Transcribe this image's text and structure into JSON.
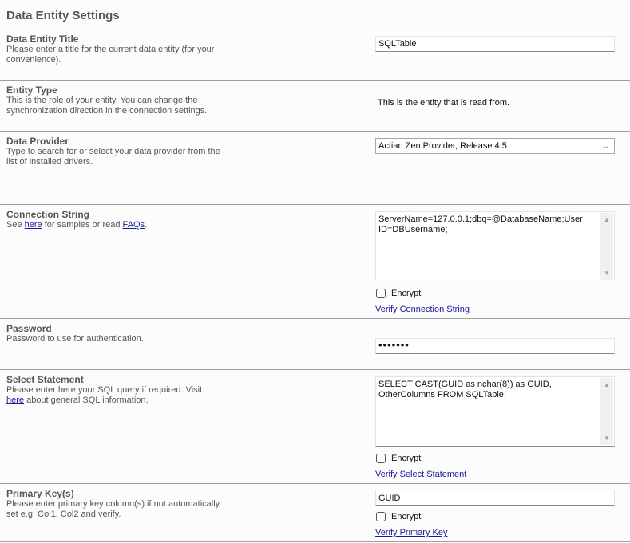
{
  "page": {
    "title": "Data Entity Settings"
  },
  "sections": {
    "entity_title": {
      "title": "Data Entity Title",
      "description": "Please enter a title for the current data entity (for your convenience).",
      "value": "SQLTable"
    },
    "entity_type": {
      "title": "Entity Type",
      "description": "This is the role of your entity. You can change the synchronization direction in the connection settings.",
      "value": "This is the entity that is read from."
    },
    "data_provider": {
      "title": "Data Provider",
      "description": "Type to search for or select your data provider from the list of installed drivers.",
      "selected": "Actian Zen Provider, Release 4.5",
      "chevron_icon": "chevron-down-icon"
    },
    "connection_string": {
      "title": "Connection String",
      "desc_prefix": "See ",
      "desc_link1": "here",
      "desc_middle": " for samples or read ",
      "desc_link2": "FAQs",
      "desc_suffix": ".",
      "value": "ServerName=127.0.0.1;dbq=@DatabaseName;User ID=DBUsername;",
      "encrypt_label": "Encrypt",
      "encrypt_checked": false,
      "verify_label": "Verify Connection String"
    },
    "password": {
      "title": "Password",
      "description": "Password to use for authentication.",
      "masked_value": "•••••••"
    },
    "select_statement": {
      "title": "Select Statement",
      "desc_prefix": "Please enter here your SQL query if required. Visit ",
      "desc_link": "here",
      "desc_suffix": " about general SQL information.",
      "value": "SELECT CAST(GUID as nchar(8)) as GUID, OtherColumns FROM SQLTable;",
      "encrypt_label": "Encrypt",
      "encrypt_checked": false,
      "verify_label": "Verify Select Statement"
    },
    "primary_key": {
      "title": "Primary Key(s)",
      "description": "Please enter primary key column(s) if not automatically set e.g. Col1, Col2 and verify.",
      "value": "GUID",
      "encrypt_label": "Encrypt",
      "encrypt_checked": false,
      "verify_label": "Verify Primary Key"
    }
  },
  "colors": {
    "link": "#1a1a9c",
    "divider": "#a0a0a0",
    "heading": "#555555"
  }
}
